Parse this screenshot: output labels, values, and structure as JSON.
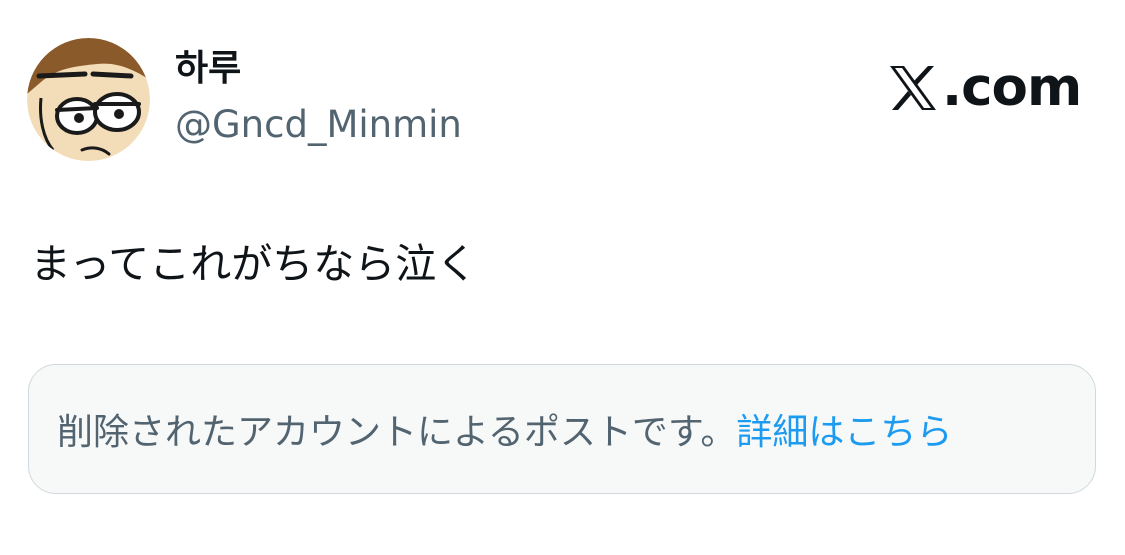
{
  "author": {
    "display_name": "하루",
    "handle": "@Gncd_Minmin",
    "avatar_icon": "cartoon-face-avatar"
  },
  "brand": {
    "logo_icon": "x-logo-icon",
    "label": ".com"
  },
  "post": {
    "text": "まってこれがちなら泣く"
  },
  "deleted_notice": {
    "message": "削除されたアカウントによるポストです。",
    "link_label": "詳細はこちら"
  },
  "colors": {
    "text_primary": "#0f1419",
    "text_secondary": "#536471",
    "link": "#1d9bf0",
    "notice_bg": "#f7f9f9",
    "notice_border": "#cfd9de"
  }
}
